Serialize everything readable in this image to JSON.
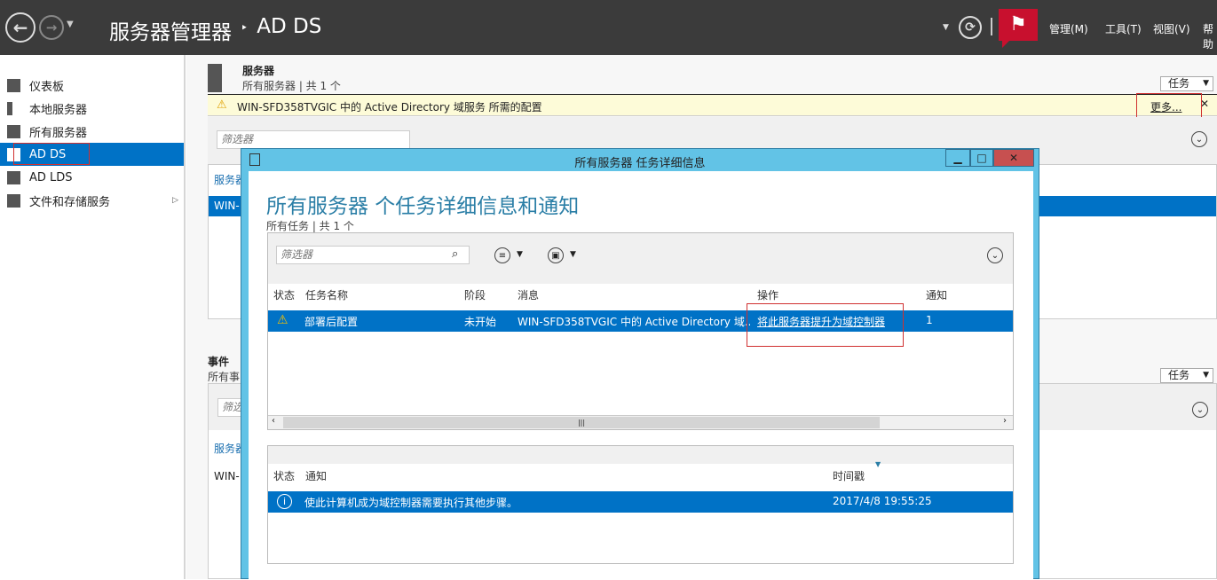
{
  "header": {
    "title": "服务器管理器",
    "breadcrumb_sep": "‣",
    "page": "AD DS",
    "menus": [
      "管理(M)",
      "工具(T)",
      "视图(V)",
      "帮助"
    ]
  },
  "sidebar": {
    "items": [
      {
        "label": "仪表板"
      },
      {
        "label": "本地服务器"
      },
      {
        "label": "所有服务器"
      },
      {
        "label": "AD DS",
        "selected": true
      },
      {
        "label": "AD LDS"
      },
      {
        "label": "文件和存储服务"
      }
    ]
  },
  "servers": {
    "title": "服务器",
    "subtitle": "所有服务器 | 共 1 个",
    "tasks": "任务",
    "banner": "WIN-SFD358TVGIC 中的 Active Directory 域服务 所需的配置",
    "more": "更多...",
    "filter_placeholder": "筛选器",
    "col": "服务器",
    "row": "WIN-"
  },
  "events": {
    "title": "事件",
    "subtitle": "所有事",
    "tasks": "任务",
    "filter_placeholder": "筛选",
    "col": "服务器",
    "row": "WIN-"
  },
  "dialog": {
    "title": "所有服务器 任务详细信息",
    "heading": "所有服务器 个任务详细信息和通知",
    "subtitle": "所有任务 | 共 1 个",
    "filter_placeholder": "筛选器",
    "columns": [
      "状态",
      "任务名称",
      "阶段",
      "消息",
      "操作",
      "通知"
    ],
    "row": {
      "name": "部署后配置",
      "stage": "未开始",
      "message": "WIN-SFD358TVGIC 中的 Active Directory 域...",
      "action": "将此服务器提升为域控制器",
      "notify": "1"
    },
    "notif_columns": [
      "状态",
      "通知",
      "时间戳"
    ],
    "notif_row": {
      "text": "使此计算机成为域控制器需要执行其他步骤。",
      "time": "2017/4/8 19:55:25"
    }
  },
  "colors": {
    "accent": "#0072c6",
    "dialog_frame": "#62c3e6",
    "flag": "#c8102e",
    "banner": "#fdfbd8"
  }
}
